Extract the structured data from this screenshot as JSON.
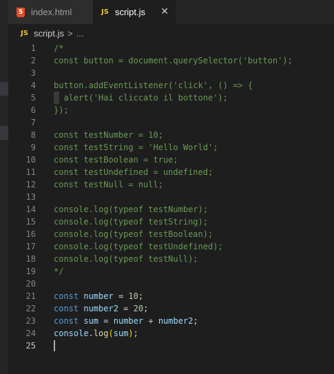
{
  "tabs": [
    {
      "label": "index.html",
      "icon": "5",
      "active": false
    },
    {
      "label": "script.js",
      "icon": "JS",
      "active": true,
      "close": "✕"
    }
  ],
  "breadcrumb": {
    "icon": "JS",
    "file": "script.js",
    "sep": ">",
    "rest": "..."
  },
  "editor": {
    "active_line": 25,
    "lines": [
      "/*",
      "const button = document.querySelector('button');",
      "",
      "button.addEventListener('click', () => {",
      "  alert('Hai cliccato il bottone');",
      "});",
      "",
      "const testNumber = 10;",
      "const testString = 'Hello World';",
      "const testBoolean = true;",
      "const testUndefined = undefined;",
      "const testNull = null;",
      "",
      "console.log(typeof testNumber);",
      "console.log(typeof testString);",
      "console.log(typeof testBoolean);",
      "console.log(typeof testUndefined);",
      "console.log(typeof testNull);",
      "*/",
      "",
      "const number = 10;",
      "const number2 = 20;",
      "const sum = number + number2;",
      "console.log(sum);",
      ""
    ]
  },
  "colors": {
    "comment": "#6a9955",
    "keyword": "#569cd6",
    "variable": "#9cdcfe",
    "number": "#b5cea8",
    "function": "#dcdcaa"
  }
}
